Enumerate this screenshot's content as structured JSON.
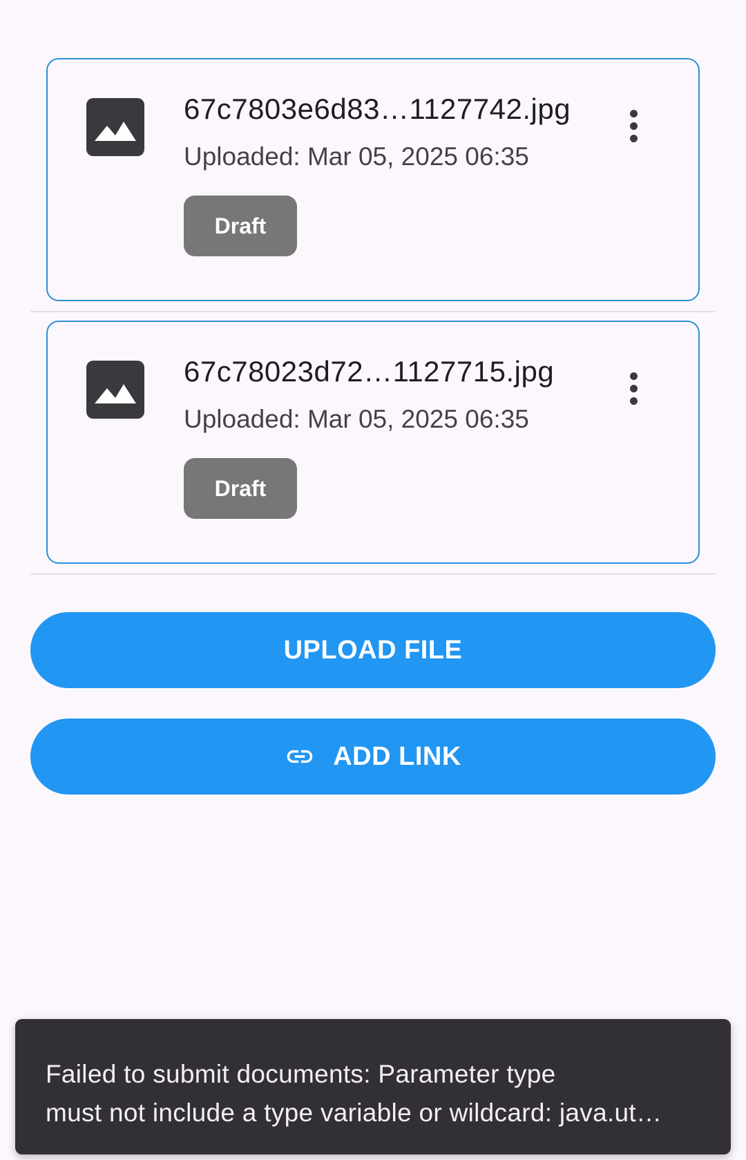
{
  "files": [
    {
      "thumbnail_icon": "image-icon",
      "name": "67c7803e6d83…1127742.jpg",
      "uploaded": "Uploaded: Mar 05, 2025 06:35",
      "status": "Draft",
      "menu_icon": "more-vert-icon"
    },
    {
      "thumbnail_icon": "image-icon",
      "name": "67c78023d72…1127715.jpg",
      "uploaded": "Uploaded: Mar 05, 2025 06:35",
      "status": "Draft",
      "menu_icon": "more-vert-icon"
    }
  ],
  "actions": {
    "upload_label": "UPLOAD FILE",
    "add_link_label": "ADD LINK",
    "add_link_icon": "link-icon"
  },
  "snackbar": {
    "line1": "Failed to submit documents: Parameter type",
    "line2": "must not include a type variable or wildcard: java.ut…"
  },
  "colors": {
    "background": "#fcf7fc",
    "card_border": "#2a8fd6",
    "badge_draft": "#777777",
    "primary_button": "#2196f3",
    "snackbar_bg": "#323035"
  }
}
